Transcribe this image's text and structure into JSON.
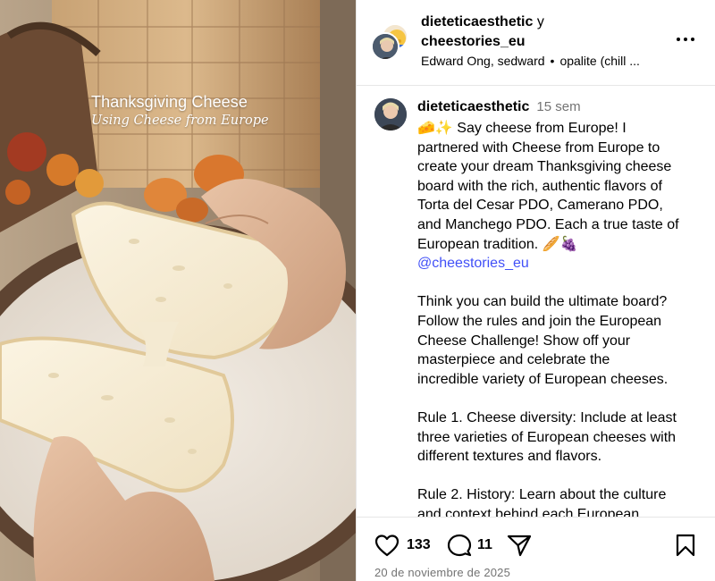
{
  "media": {
    "overlay_title": "Thanksgiving Cheese",
    "overlay_subtitle": "Using Cheese from Europe"
  },
  "header": {
    "author": "dieteticaesthetic",
    "conjunction": "y",
    "collaborator": "cheestories_eu",
    "tagged_people": "Edward Ong, sedward",
    "audio": "opalite (chill ...",
    "more_icon": "more-horizontal-icon"
  },
  "caption": {
    "username": "dieteticaesthetic",
    "time_ago": "15 sem",
    "lines": [
      "🧀✨ Say cheese from Europe! I",
      "partnered with Cheese from Europe to",
      "create your dream Thanksgiving cheese",
      "board with the rich, authentic flavors of",
      "Torta del Cesar PDO, Camerano PDO,",
      "and Manchego PDO. Each a true taste of",
      "European tradition. 🥖🍇"
    ],
    "mention": "@cheestories_eu",
    "paragraph2": [
      "Think you can build the ultimate board?",
      "Follow the rules and join the European",
      "Cheese Challenge! Show off your",
      "masterpiece and celebrate the",
      "incredible variety of European cheeses."
    ],
    "paragraph3": [
      "Rule 1. Cheese diversity: Include at least",
      "three varieties of European cheeses with",
      "different textures and flavors."
    ],
    "paragraph4": [
      "Rule 2. History: Learn about the culture",
      "and context behind each European"
    ]
  },
  "actions": {
    "like_icon": "heart-icon",
    "like_count": "133",
    "comment_icon": "comment-icon",
    "comment_count": "11",
    "share_icon": "send-icon",
    "save_icon": "bookmark-icon"
  },
  "post_date": "20 de noviembre de 2025"
}
